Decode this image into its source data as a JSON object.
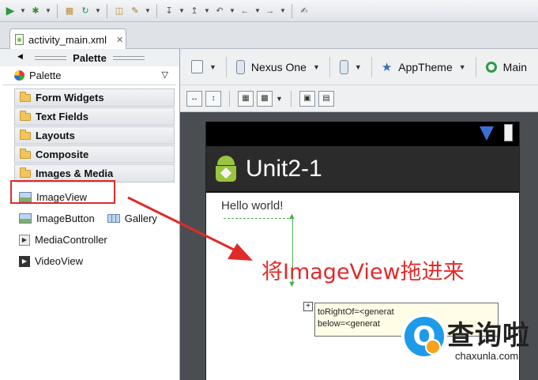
{
  "editor_tab": {
    "file_name": "activity_main.xml"
  },
  "palette": {
    "title": "Palette",
    "selector_label": "Palette",
    "categories": [
      "Form Widgets",
      "Text Fields",
      "Layouts",
      "Composite",
      "Images & Media"
    ],
    "items": {
      "imageview": "ImageView",
      "imagebutton": "ImageButton",
      "gallery": "Gallery",
      "mediacontroller": "MediaController",
      "videoview": "VideoView"
    }
  },
  "config_bar": {
    "device": "Nexus One",
    "theme": "AppTheme",
    "activity": "Main"
  },
  "device_preview": {
    "app_title": "Unit2-1",
    "hello_text": "Hello world!"
  },
  "tooltip": {
    "line1": "toRightOf=<generat",
    "line2": "below=<generat"
  },
  "annotation": {
    "text": "将ImageView拖进来"
  },
  "watermark": {
    "brand": "查询啦",
    "url": "chaxunla.com"
  },
  "colors": {
    "annotation_red": "#e02a2a",
    "android_green": "#9ac440",
    "watermark_blue": "#1e9be8"
  }
}
